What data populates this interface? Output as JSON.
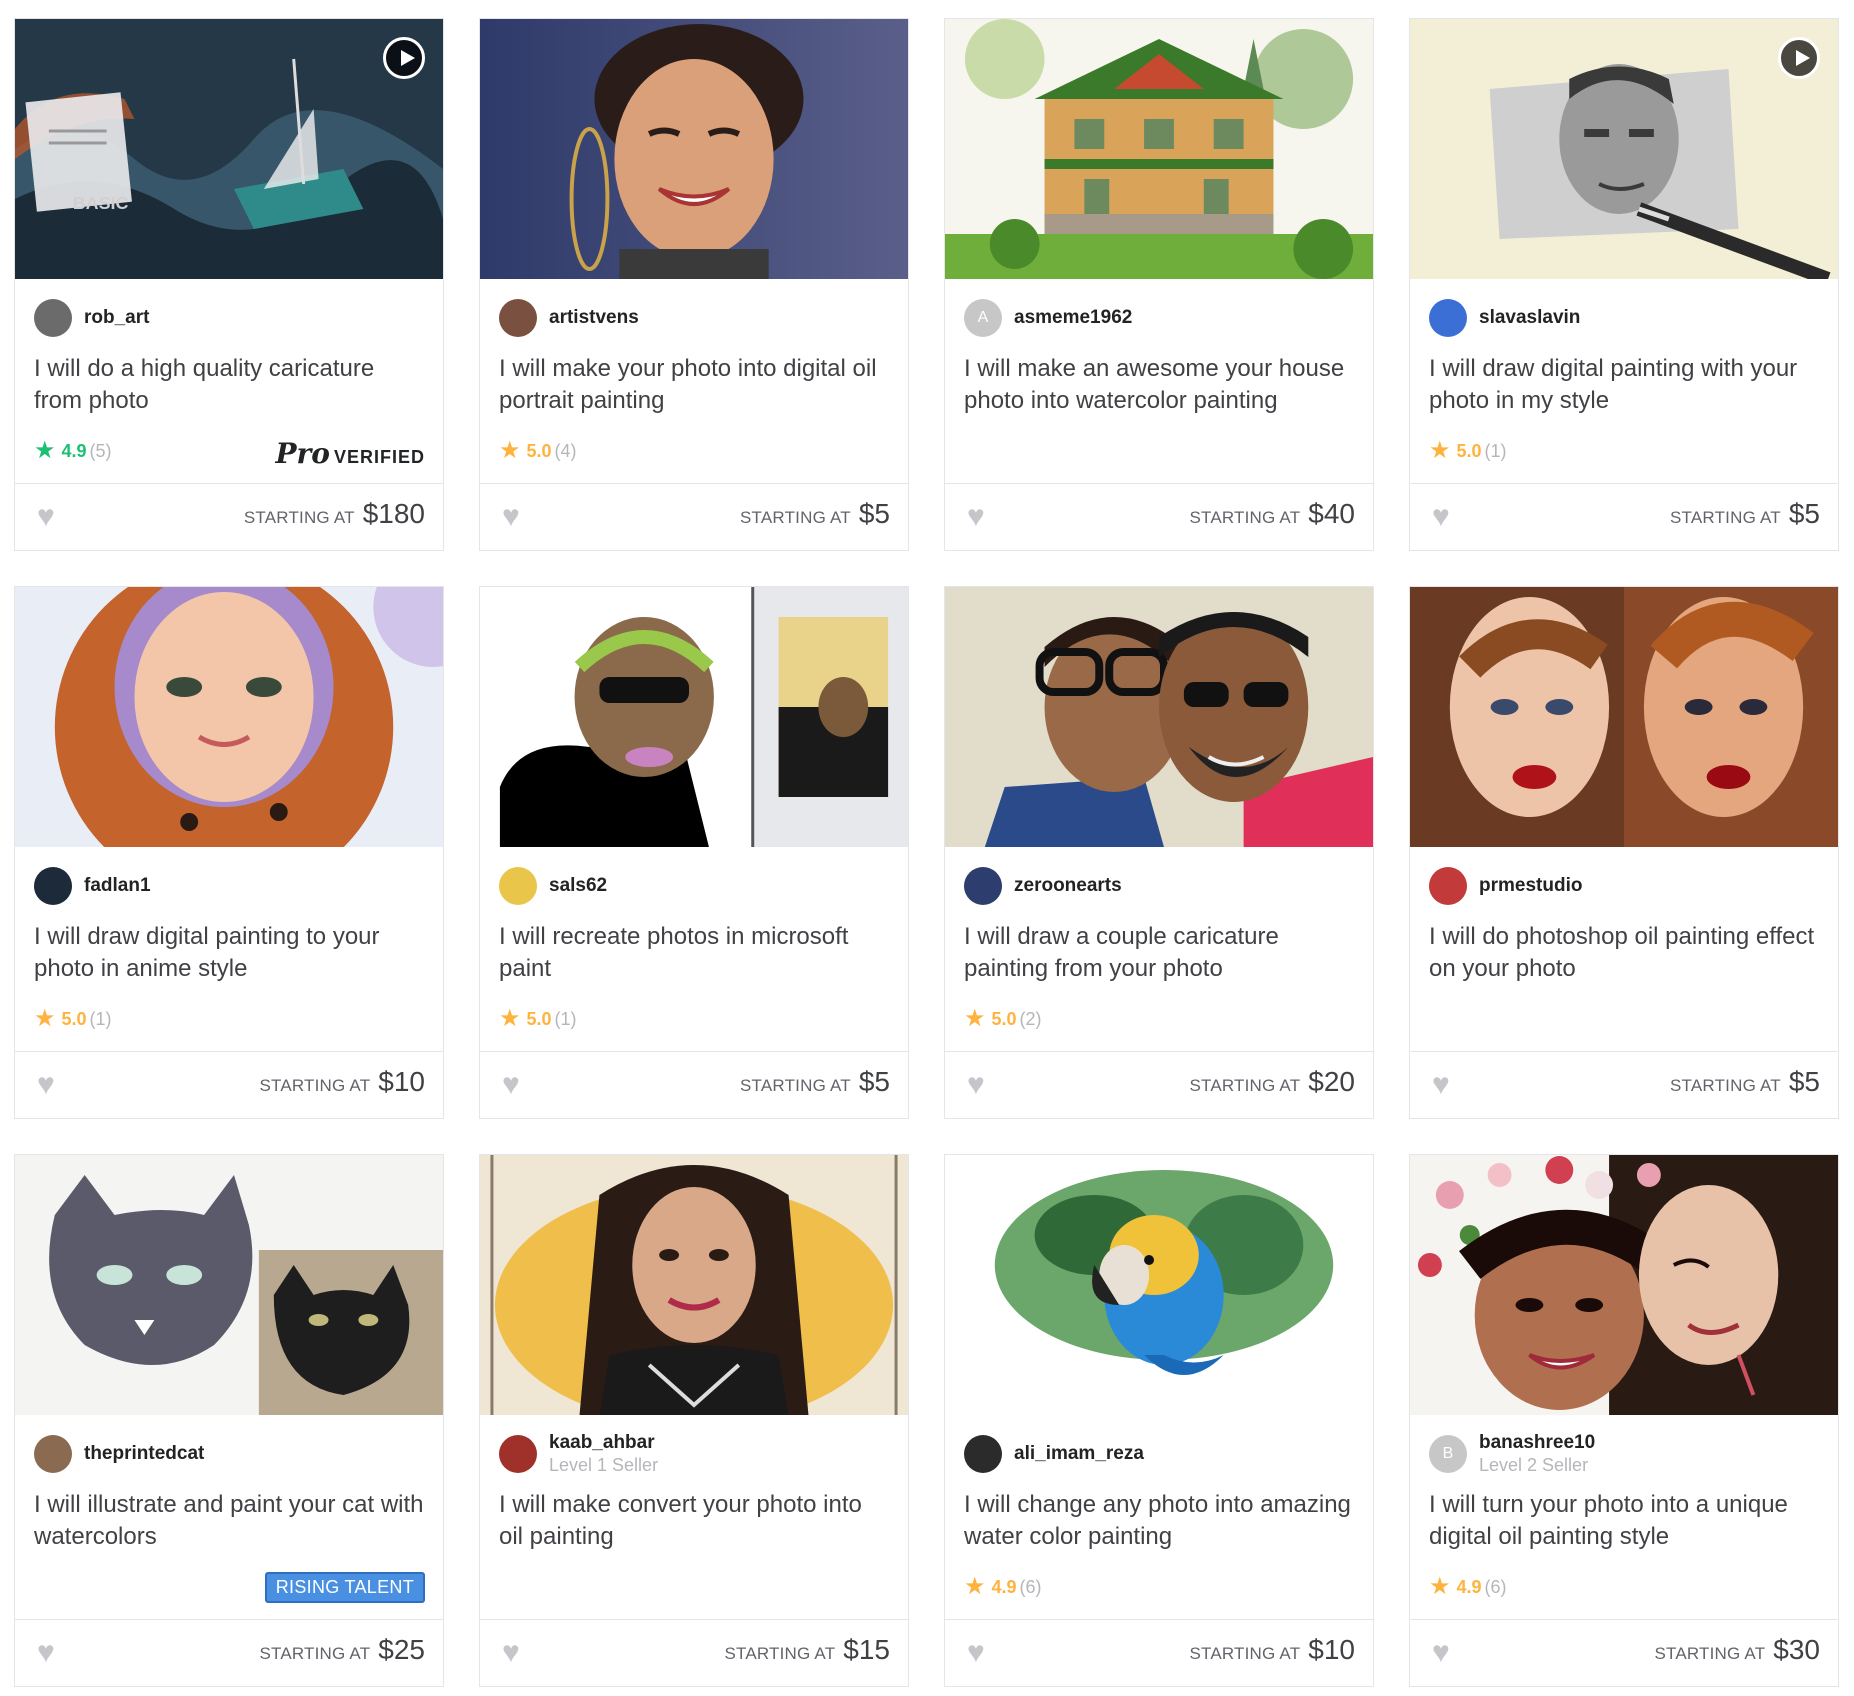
{
  "gigs": [
    {
      "seller": "rob_art",
      "level": "",
      "title": "I will do a high quality caricature from photo",
      "score": "4.9",
      "count": "(5)",
      "badge": "pro",
      "price_label": "STARTING AT",
      "price": "$180",
      "video": true,
      "star_color": "#1dbf73",
      "avatar_color": "#6b6b6b",
      "avatar_letter": "",
      "thumb_label": "BASIC"
    },
    {
      "seller": "artistvens",
      "level": "",
      "title": "I will make your photo into digital oil portrait painting",
      "score": "5.0",
      "count": "(4)",
      "badge": "",
      "price_label": "STARTING AT",
      "price": "$5",
      "video": false,
      "star_color": "#ffb33e",
      "avatar_color": "#7a5040",
      "avatar_letter": "",
      "thumb_label": ""
    },
    {
      "seller": "asmeme1962",
      "level": "",
      "title": "I will make an awesome your house photo into watercolor painting",
      "score": "",
      "count": "",
      "badge": "",
      "price_label": "STARTING AT",
      "price": "$40",
      "video": false,
      "star_color": "#ffb33e",
      "avatar_color": "#c7c7c7",
      "avatar_letter": "A",
      "thumb_label": ""
    },
    {
      "seller": "slavaslavin",
      "level": "",
      "title": "I will draw digital painting with your photo in my style",
      "score": "5.0",
      "count": "(1)",
      "badge": "",
      "price_label": "STARTING AT",
      "price": "$5",
      "video": true,
      "star_color": "#ffb33e",
      "avatar_color": "#3b6fd6",
      "avatar_letter": "",
      "thumb_label": ""
    },
    {
      "seller": "fadlan1",
      "level": "",
      "title": "I will draw digital painting to your photo in anime style",
      "score": "5.0",
      "count": "(1)",
      "badge": "",
      "price_label": "STARTING AT",
      "price": "$10",
      "video": false,
      "star_color": "#ffb33e",
      "avatar_color": "#1c2a3a",
      "avatar_letter": "",
      "thumb_label": ""
    },
    {
      "seller": "sals62",
      "level": "",
      "title": "I will recreate photos in microsoft paint",
      "score": "5.0",
      "count": "(1)",
      "badge": "",
      "price_label": "STARTING AT",
      "price": "$5",
      "video": false,
      "star_color": "#ffb33e",
      "avatar_color": "#e9c64a",
      "avatar_letter": "",
      "thumb_label": ""
    },
    {
      "seller": "zeroonearts",
      "level": "",
      "title": "I will draw a couple caricature painting from your photo",
      "score": "5.0",
      "count": "(2)",
      "badge": "",
      "price_label": "STARTING AT",
      "price": "$20",
      "video": false,
      "star_color": "#ffb33e",
      "avatar_color": "#2d3e6e",
      "avatar_letter": "",
      "thumb_label": ""
    },
    {
      "seller": "prmestudio",
      "level": "",
      "title": "I will do photoshop oil painting effect on your photo",
      "score": "",
      "count": "",
      "badge": "",
      "price_label": "STARTING AT",
      "price": "$5",
      "video": false,
      "star_color": "#ffb33e",
      "avatar_color": "#c23a3a",
      "avatar_letter": "",
      "thumb_label": ""
    },
    {
      "seller": "theprintedcat",
      "level": "",
      "title": "I will illustrate and paint your cat with watercolors",
      "score": "",
      "count": "",
      "badge": "rising",
      "badge_text": "RISING TALENT",
      "price_label": "STARTING AT",
      "price": "$25",
      "video": false,
      "star_color": "#ffb33e",
      "avatar_color": "#8a6a50",
      "avatar_letter": "",
      "thumb_label": ""
    },
    {
      "seller": "kaab_ahbar",
      "level": "Level 1 Seller",
      "title": "I will make convert your photo into oil painting",
      "score": "",
      "count": "",
      "badge": "",
      "price_label": "STARTING AT",
      "price": "$15",
      "video": false,
      "star_color": "#ffb33e",
      "avatar_color": "#a0302a",
      "avatar_letter": "",
      "thumb_label": ""
    },
    {
      "seller": "ali_imam_reza",
      "level": "",
      "title": "I will change any photo into amazing water color painting",
      "score": "4.9",
      "count": "(6)",
      "badge": "",
      "price_label": "STARTING AT",
      "price": "$10",
      "video": false,
      "star_color": "#ffb33e",
      "avatar_color": "#2b2b2b",
      "avatar_letter": "",
      "thumb_label": ""
    },
    {
      "seller": "banashree10",
      "level": "Level 2 Seller",
      "title": "I will turn your photo into a unique digital oil painting style",
      "score": "4.9",
      "count": "(6)",
      "badge": "",
      "price_label": "STARTING AT",
      "price": "$30",
      "video": false,
      "star_color": "#ffb33e",
      "avatar_color": "#c7c7c7",
      "avatar_letter": "B",
      "thumb_label": ""
    }
  ],
  "pro_badge": {
    "logo": "Pro",
    "text": "VERIFIED"
  }
}
